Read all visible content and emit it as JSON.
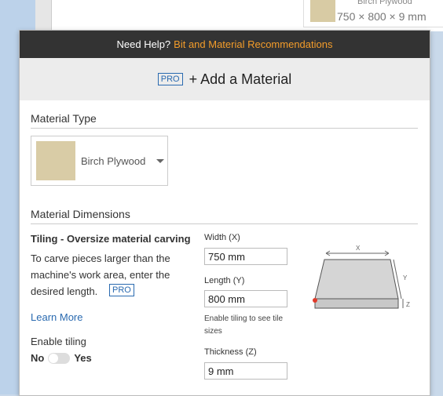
{
  "background": {
    "card_name": "Birch Plywood",
    "card_dims": "750 × 800 × 9 mm"
  },
  "help_bar": {
    "prefix": "Need Help?",
    "link": "Bit and Material Recommendations"
  },
  "header": {
    "pro_badge": "PRO",
    "title": "+ Add a Material"
  },
  "material_type": {
    "heading": "Material Type",
    "selected": "Birch Plywood"
  },
  "dimensions": {
    "heading": "Material Dimensions",
    "tiling_title": "Tiling - Oversize material carving",
    "tiling_desc": "To carve pieces larger than the machine's work area, enter the desired length.",
    "pro_badge": "PRO",
    "learn_more": "Learn More",
    "enable_tiling": "Enable tiling",
    "toggle_no": "No",
    "toggle_yes": "Yes",
    "width_label": "Width (X)",
    "width_value": "750 mm",
    "length_label": "Length (Y)",
    "length_value": "800 mm",
    "tiling_hint": "Enable tiling to see tile sizes",
    "thickness_label": "Thickness (Z)",
    "thickness_value": "9 mm",
    "diagram": {
      "x": "X",
      "y": "Y",
      "z": "Z"
    }
  },
  "colors": {
    "help_link": "#f39c2a",
    "accent": "#2a6ab0",
    "help_bar_bg": "#333333"
  }
}
